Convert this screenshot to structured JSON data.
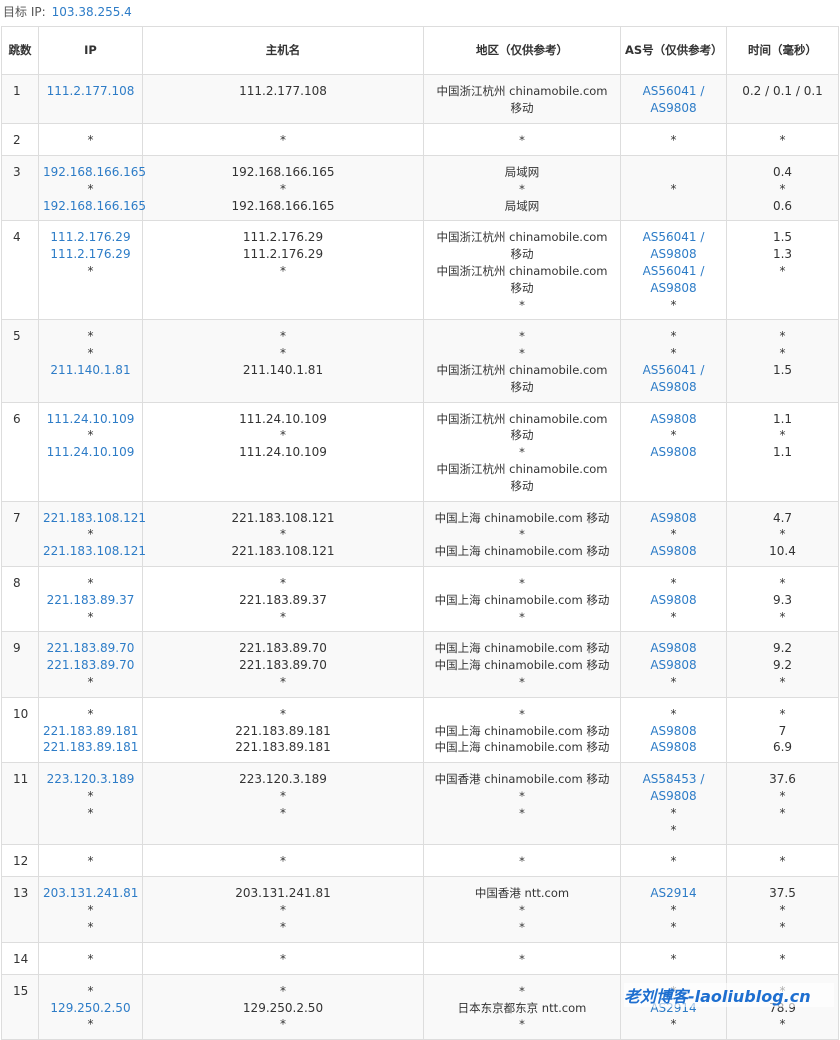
{
  "target": {
    "label": "目标 IP:",
    "ip": "103.38.255.4"
  },
  "headers": {
    "hop": "跳数",
    "ip": "IP",
    "host": "主机名",
    "loc": "地区（仅供参考）",
    "asn": "AS号（仅供参考）",
    "time": "时间（毫秒）"
  },
  "rows": [
    {
      "hop": "1",
      "ip": [
        "111.2.177.108"
      ],
      "host": [
        "111.2.177.108"
      ],
      "loc": [
        "中国浙江杭州 chinamobile.com",
        "移动"
      ],
      "asn": [
        "AS56041 /",
        "AS9808"
      ],
      "time": [
        "0.2 / 0.1 / 0.1"
      ]
    },
    {
      "hop": "2",
      "ip": [
        "*"
      ],
      "host": [
        "*"
      ],
      "loc": [
        "*"
      ],
      "asn": [
        "*"
      ],
      "time": [
        "*"
      ]
    },
    {
      "hop": "3",
      "ip": [
        "192.168.166.165",
        "*",
        "192.168.166.165"
      ],
      "host": [
        "192.168.166.165",
        "*",
        "192.168.166.165"
      ],
      "loc": [
        "局域网",
        "*",
        "局域网"
      ],
      "asn": [
        "",
        "*",
        ""
      ],
      "time": [
        "0.4",
        "*",
        "0.6"
      ]
    },
    {
      "hop": "4",
      "ip": [
        "111.2.176.29",
        "111.2.176.29",
        "*"
      ],
      "host": [
        "111.2.176.29",
        "111.2.176.29",
        "*"
      ],
      "loc": [
        "中国浙江杭州 chinamobile.com",
        "移动",
        "中国浙江杭州 chinamobile.com",
        "移动",
        "*"
      ],
      "asn": [
        "AS56041 /",
        "AS9808",
        "AS56041 /",
        "AS9808",
        "*"
      ],
      "time": [
        "1.5",
        "1.3",
        "*"
      ]
    },
    {
      "hop": "5",
      "ip": [
        "*",
        "*",
        "211.140.1.81"
      ],
      "host": [
        "*",
        "*",
        "211.140.1.81"
      ],
      "loc": [
        "*",
        "*",
        "中国浙江杭州 chinamobile.com",
        "移动"
      ],
      "asn": [
        "*",
        "*",
        "AS56041 /",
        "AS9808"
      ],
      "time": [
        "*",
        "*",
        "1.5"
      ]
    },
    {
      "hop": "6",
      "ip": [
        "111.24.10.109",
        "*",
        "111.24.10.109"
      ],
      "host": [
        "111.24.10.109",
        "*",
        "111.24.10.109"
      ],
      "loc": [
        "中国浙江杭州 chinamobile.com",
        "移动",
        "*",
        "中国浙江杭州 chinamobile.com",
        "移动"
      ],
      "asn": [
        "AS9808",
        "*",
        "AS9808"
      ],
      "time": [
        "1.1",
        "*",
        "1.1"
      ]
    },
    {
      "hop": "7",
      "ip": [
        "221.183.108.121",
        "*",
        "221.183.108.121"
      ],
      "host": [
        "221.183.108.121",
        "*",
        "221.183.108.121"
      ],
      "loc": [
        "中国上海 chinamobile.com 移动",
        "*",
        "中国上海 chinamobile.com 移动"
      ],
      "asn": [
        "AS9808",
        "*",
        "AS9808"
      ],
      "time": [
        "4.7",
        "*",
        "10.4"
      ]
    },
    {
      "hop": "8",
      "ip": [
        "*",
        "221.183.89.37",
        "*"
      ],
      "host": [
        "*",
        "221.183.89.37",
        "*"
      ],
      "loc": [
        "*",
        "中国上海 chinamobile.com 移动",
        "*"
      ],
      "asn": [
        "*",
        "AS9808",
        "*"
      ],
      "time": [
        "*",
        "9.3",
        "*"
      ]
    },
    {
      "hop": "9",
      "ip": [
        "221.183.89.70",
        "221.183.89.70",
        "*"
      ],
      "host": [
        "221.183.89.70",
        "221.183.89.70",
        "*"
      ],
      "loc": [
        "中国上海 chinamobile.com 移动",
        "中国上海 chinamobile.com 移动",
        "*"
      ],
      "asn": [
        "AS9808",
        "AS9808",
        "*"
      ],
      "time": [
        "9.2",
        "9.2",
        "*"
      ]
    },
    {
      "hop": "10",
      "ip": [
        "*",
        "221.183.89.181",
        "221.183.89.181"
      ],
      "host": [
        "*",
        "221.183.89.181",
        "221.183.89.181"
      ],
      "loc": [
        "*",
        "中国上海 chinamobile.com 移动",
        "中国上海 chinamobile.com 移动"
      ],
      "asn": [
        "*",
        "AS9808",
        "AS9808"
      ],
      "time": [
        "*",
        "7",
        "6.9"
      ]
    },
    {
      "hop": "11",
      "ip": [
        "223.120.3.189",
        "*",
        "*"
      ],
      "host": [
        "223.120.3.189",
        "*",
        "*"
      ],
      "loc": [
        "中国香港 chinamobile.com 移动",
        "*",
        "*"
      ],
      "asn": [
        "AS58453 /",
        "AS9808",
        "*",
        "*"
      ],
      "time": [
        "37.6",
        "*",
        "*"
      ]
    },
    {
      "hop": "12",
      "ip": [
        "*"
      ],
      "host": [
        "*"
      ],
      "loc": [
        "*"
      ],
      "asn": [
        "*"
      ],
      "time": [
        "*"
      ]
    },
    {
      "hop": "13",
      "ip": [
        "203.131.241.81",
        "*",
        "*"
      ],
      "host": [
        "203.131.241.81",
        "*",
        "*"
      ],
      "loc": [
        "中国香港 ntt.com",
        "*",
        "*"
      ],
      "asn": [
        "AS2914",
        "*",
        "*"
      ],
      "time": [
        "37.5",
        "*",
        "*"
      ]
    },
    {
      "hop": "14",
      "ip": [
        "*"
      ],
      "host": [
        "*"
      ],
      "loc": [
        "*"
      ],
      "asn": [
        "*"
      ],
      "time": [
        "*"
      ]
    },
    {
      "hop": "15",
      "ip": [
        "*",
        "129.250.2.50",
        "*"
      ],
      "host": [
        "*",
        "129.250.2.50",
        "*"
      ],
      "loc": [
        "*",
        "日本东京都东京 ntt.com",
        "*"
      ],
      "asn": [
        "*",
        "AS2914",
        "*"
      ],
      "time": [
        "*",
        "78.9",
        "*"
      ]
    }
  ],
  "watermark": "老刘博客-laoliublog.cn"
}
